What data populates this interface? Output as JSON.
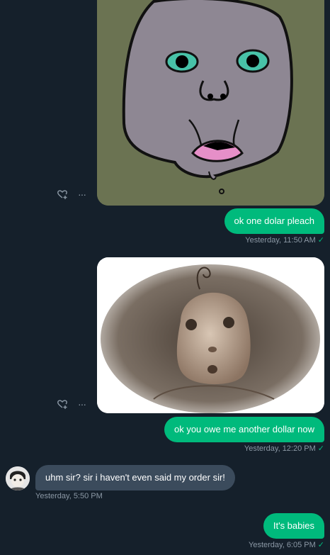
{
  "messages": [
    {
      "type": "image",
      "subject": "cartoon face drawing"
    },
    {
      "type": "sent",
      "text": "ok one dolar pleach",
      "time": "Yesterday, 11:50 AM"
    },
    {
      "type": "image",
      "subject": "pencil sketch of a baby"
    },
    {
      "type": "sent",
      "text": "ok you owe me another dollar now",
      "time": "Yesterday, 12:20 PM"
    },
    {
      "type": "received",
      "text": "uhm sir? sir i haven't even said my order sir!",
      "time": "Yesterday, 5:50 PM"
    },
    {
      "type": "sent",
      "text": "It's babies",
      "time": "Yesterday, 6:05 PM"
    }
  ],
  "icons": {
    "react": "heart-plus-icon",
    "more": "more-icon",
    "read": "check-icon"
  },
  "colors": {
    "background": "#15202b",
    "sent": "#00ba7c",
    "received": "#3b4b5c",
    "meta": "#8b98a5"
  },
  "read_mark": "✓",
  "more_glyph": "···"
}
